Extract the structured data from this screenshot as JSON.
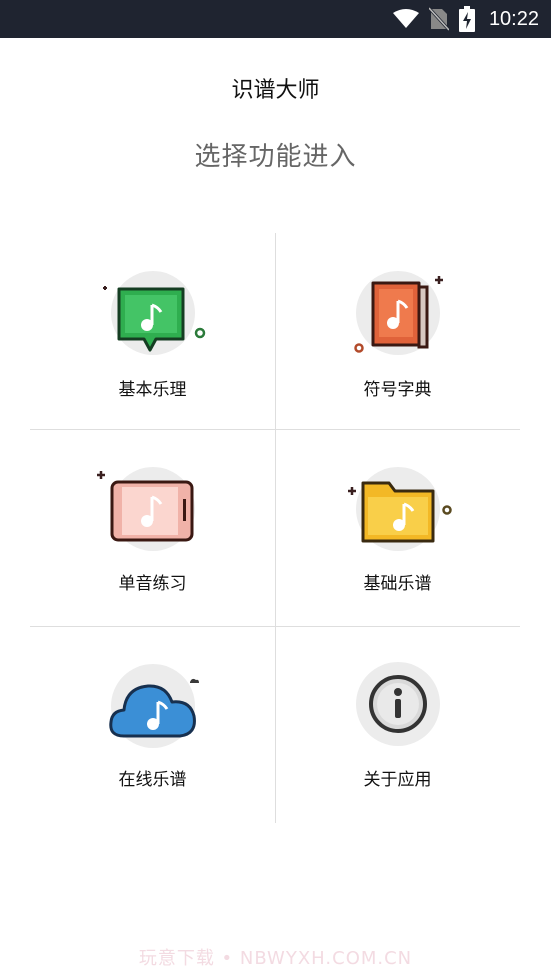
{
  "status_bar": {
    "time": "10:22",
    "icons": [
      "wifi-icon",
      "no-sim-icon",
      "battery-charging-icon"
    ]
  },
  "app_bar": {
    "title": "识谱大师"
  },
  "subtitle": "选择功能进入",
  "menu": [
    {
      "label": "基本乐理",
      "icon": "speech-bubble-music-icon"
    },
    {
      "label": "符号字典",
      "icon": "music-book-icon"
    },
    {
      "label": "单音练习",
      "icon": "tablet-music-icon"
    },
    {
      "label": "基础乐谱",
      "icon": "folder-music-icon"
    },
    {
      "label": "在线乐谱",
      "icon": "cloud-music-icon"
    },
    {
      "label": "关于应用",
      "icon": "info-icon"
    }
  ],
  "watermark": "玩意下载 • NBWYXH.COM.CN",
  "colors": {
    "status_bar": "#1f2430",
    "green": "#2fae4f",
    "orange": "#e0623a",
    "pink": "#f0b2a8",
    "yellow": "#f7c437",
    "blue": "#3b8fd6"
  }
}
